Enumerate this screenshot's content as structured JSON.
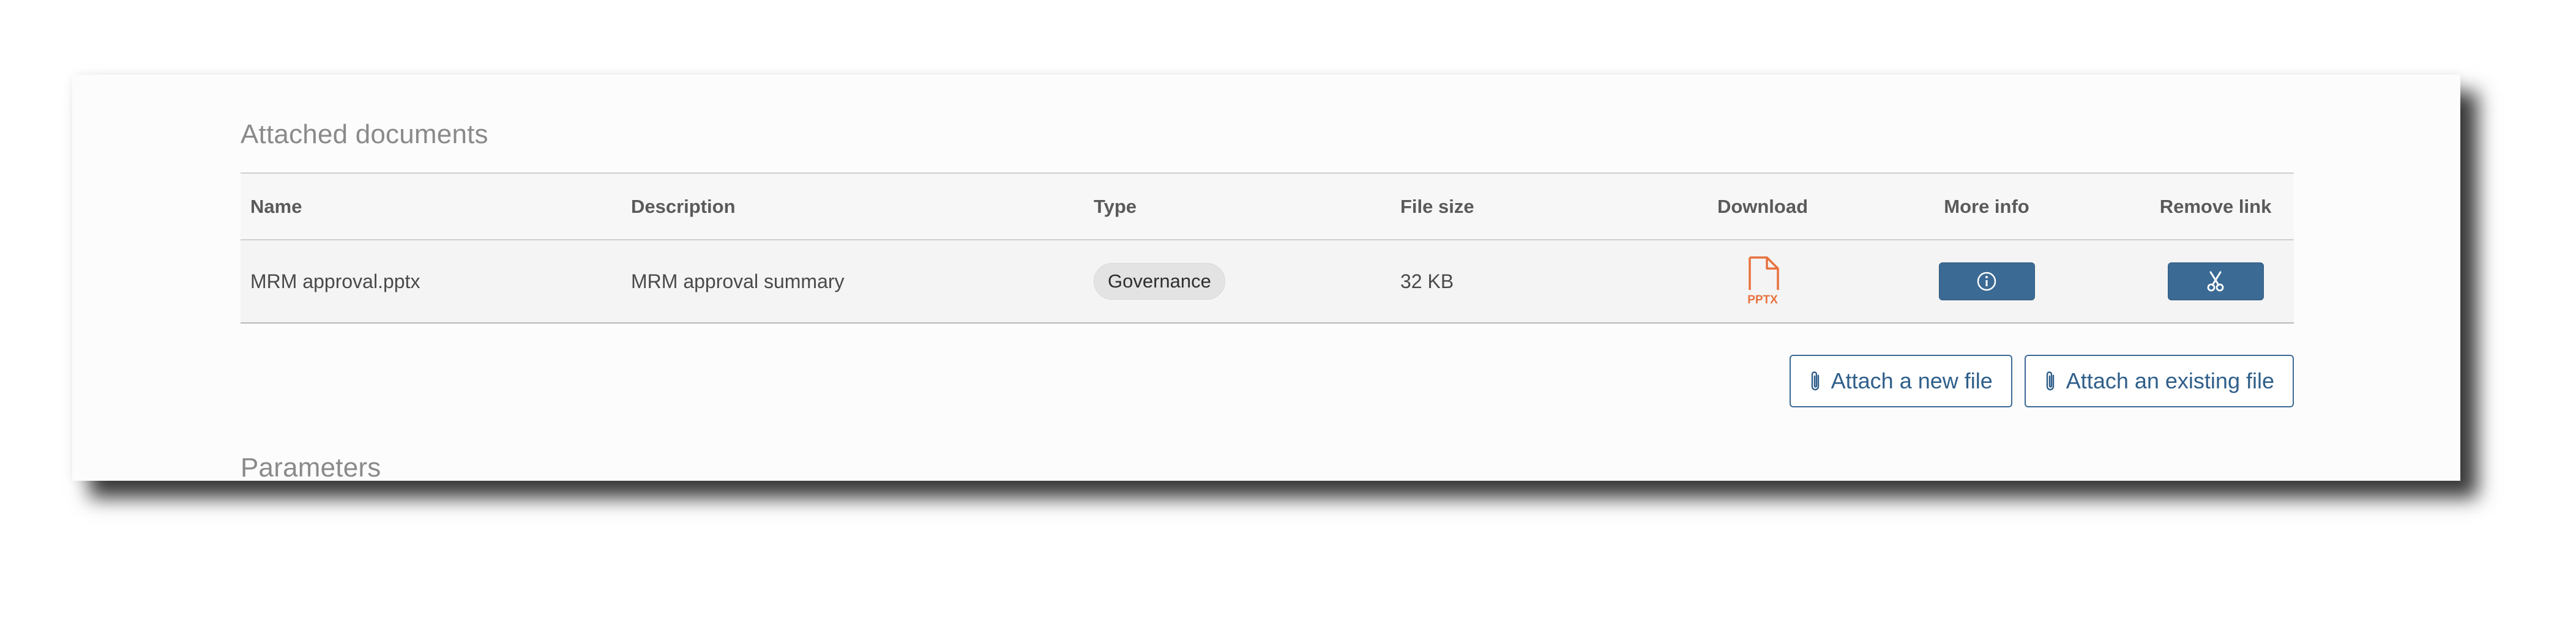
{
  "attached": {
    "title": "Attached documents",
    "columns": {
      "name": "Name",
      "description": "Description",
      "type": "Type",
      "file_size": "File size",
      "download": "Download",
      "more_info": "More info",
      "remove_link": "Remove link"
    },
    "rows": [
      {
        "name": "MRM approval.pptx",
        "description": "MRM approval summary",
        "type": "Governance",
        "file_size": "32 KB",
        "download_label": "PPTX",
        "download_icon": "pptx-file-icon",
        "more_info_icon": "info-icon",
        "remove_icon": "scissors-icon"
      }
    ],
    "actions": {
      "attach_new": "Attach a new file",
      "attach_existing": "Attach an existing file",
      "icon": "paperclip-icon"
    }
  },
  "parameters": {
    "title": "Parameters"
  },
  "colors": {
    "accent": "#3b6a94",
    "pptx": "#e8723f",
    "badge_bg": "#e3e3e3"
  }
}
